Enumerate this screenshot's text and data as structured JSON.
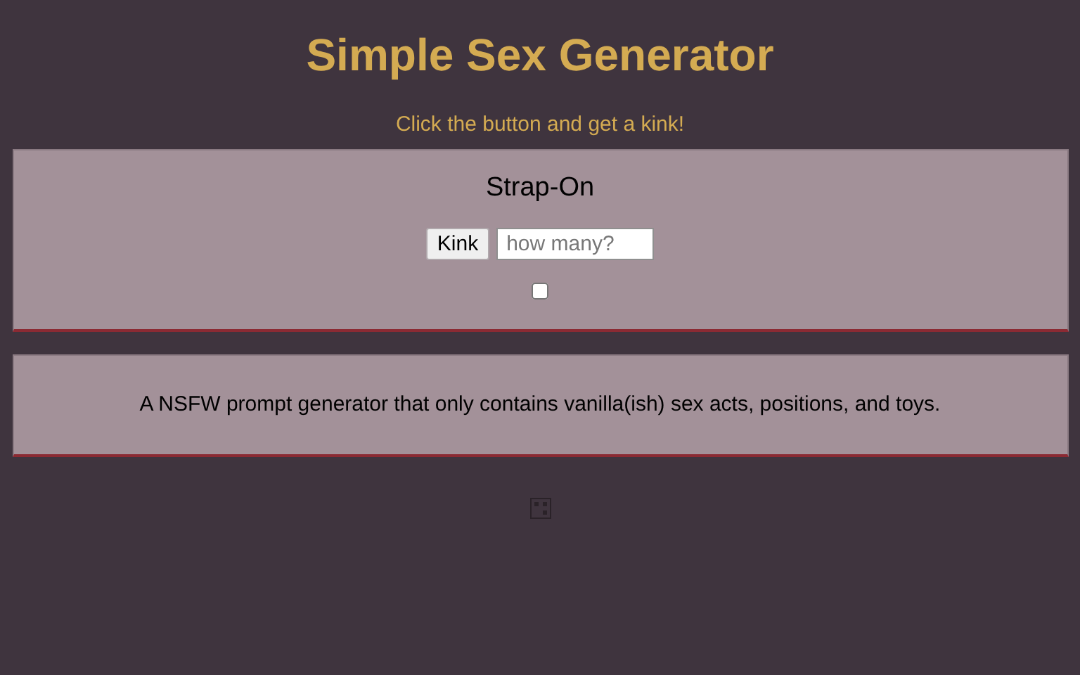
{
  "title": "Simple Sex Generator",
  "subtitle": "Click the button and get a kink!",
  "result": "Strap-On",
  "button": "Kink",
  "count_field": {
    "placeholder": "how many?"
  },
  "checkbox": {
    "checked": false
  },
  "description": "A NSFW prompt generator that only contains vanilla(ish) sex acts, positions, and toys."
}
